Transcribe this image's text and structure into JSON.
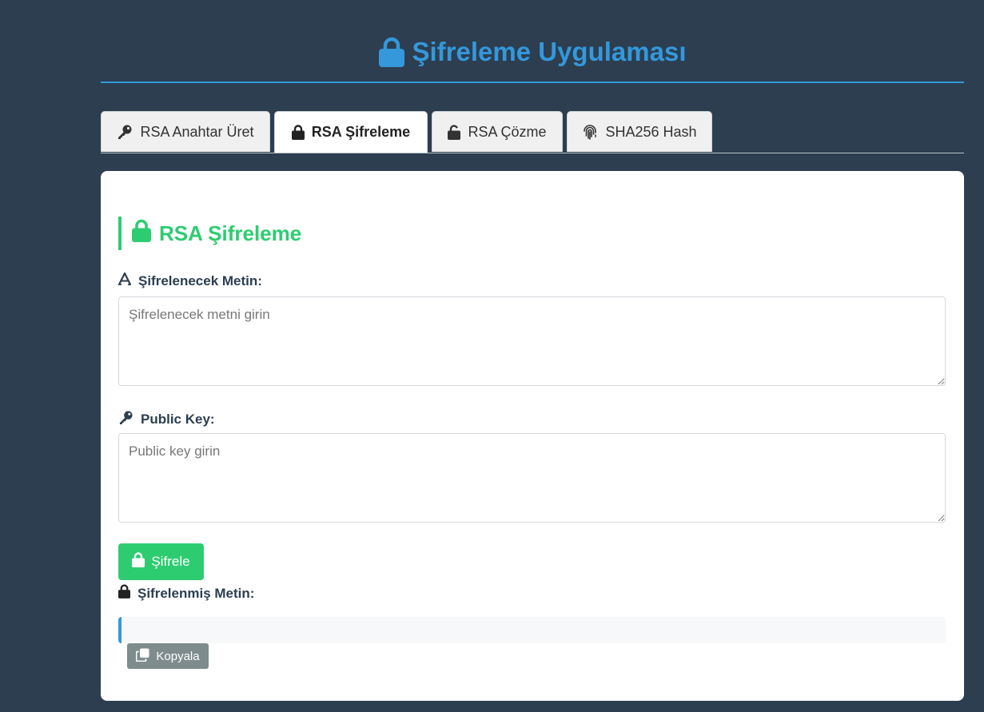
{
  "header": {
    "title": "Şifreleme Uygulaması",
    "icon": "lock-icon"
  },
  "tabs": [
    {
      "label": "RSA Anahtar Üret",
      "icon": "key-icon"
    },
    {
      "label": "RSA Şifreleme",
      "icon": "lock-icon",
      "active": true
    },
    {
      "label": "RSA Çözme",
      "icon": "unlock-icon"
    },
    {
      "label": "SHA256 Hash",
      "icon": "fingerprint-icon"
    }
  ],
  "section": {
    "title": "RSA Şifreleme",
    "icon": "lock-icon"
  },
  "form": {
    "plaintext_label": "Şifrelenecek Metin:",
    "plaintext_placeholder": "Şifrelenecek metni girin",
    "plaintext_value": "",
    "publickey_label": "Public Key:",
    "publickey_placeholder": "Public key girin",
    "publickey_value": "",
    "encrypt_button": "Şifrele",
    "output_label": "Şifrelenmiş Metin:",
    "output_value": "",
    "copy_button": "Kopyala"
  },
  "colors": {
    "background": "#2c3e50",
    "accent_blue": "#3498db",
    "accent_green": "#2ecc71",
    "copy_gray": "#7f8c8d"
  }
}
